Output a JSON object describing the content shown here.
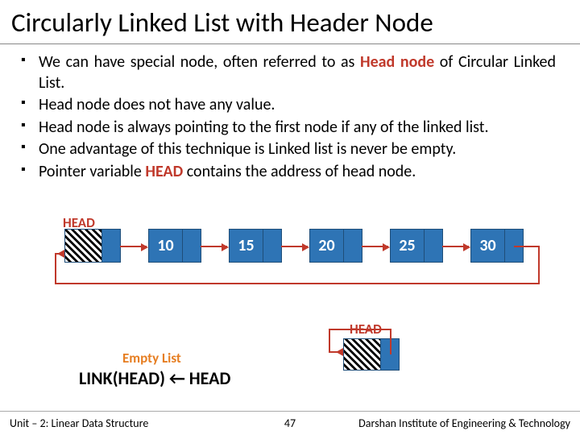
{
  "title": "Circularly Linked List with Header Node",
  "bullets": {
    "b0a": "We can have special node, often referred to as ",
    "b0b": "Head node",
    "b0c": " of Circular Linked List.",
    "b1": "Head node does not have any value.",
    "b2": "Head node is always pointing to the first node if any of the linked list.",
    "b3": "One advantage of this technique is Linked list is never be empty.",
    "b4a": "Pointer variable ",
    "b4b": "HEAD",
    "b4c": " contains the address of head node."
  },
  "labels": {
    "head_top": "HEAD",
    "head_mini": "HEAD",
    "empty": "Empty List",
    "link_expr": "LINK(HEAD) ← HEAD"
  },
  "nodes": {
    "n1": "10",
    "n2": "15",
    "n3": "20",
    "n4": "25",
    "n5": "30"
  },
  "footer": {
    "unit": "Unit – 2: Linear Data Structure",
    "page": "47",
    "org": "Darshan Institute of Engineering & Technology"
  }
}
